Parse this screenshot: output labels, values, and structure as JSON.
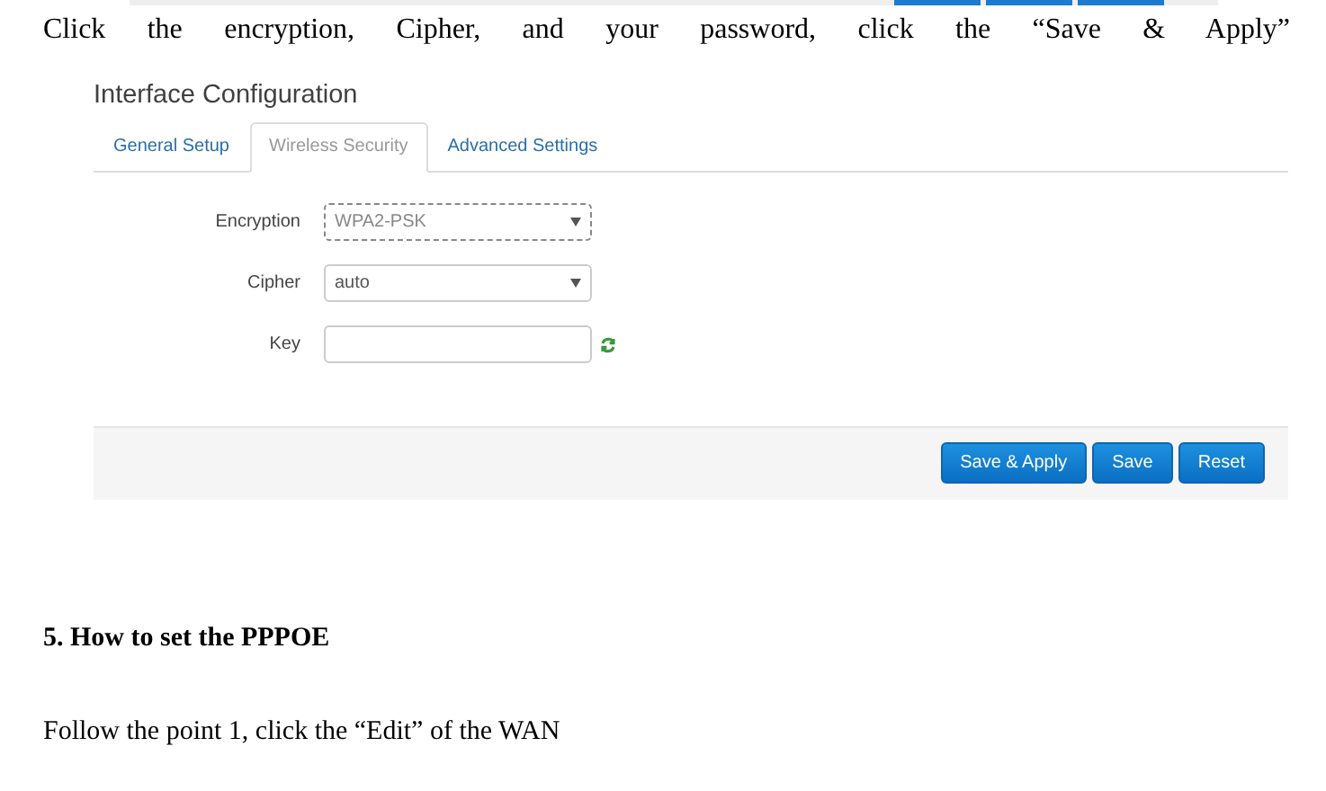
{
  "instruction": "Click the encryption, Cipher, and your password, click the “Save & Apply”",
  "screenshot": {
    "title": "Interface Configuration",
    "tabs": [
      {
        "label": "General Setup",
        "selected": false
      },
      {
        "label": "Wireless Security",
        "selected": true
      },
      {
        "label": "Advanced Settings",
        "selected": false
      }
    ],
    "fields": [
      {
        "kind": "select",
        "label": "Encryption",
        "value": "WPA2-PSK",
        "focused": true
      },
      {
        "kind": "select",
        "label": "Cipher",
        "value": "auto",
        "focused": false
      },
      {
        "kind": "text",
        "label": "Key",
        "focused": false
      }
    ],
    "buttons": [
      "Save & Apply",
      "Save",
      "Reset"
    ]
  },
  "heading": "5. How to set the PPPOE",
  "paragraph": "Follow the point 1, click the “Edit” of the WAN"
}
